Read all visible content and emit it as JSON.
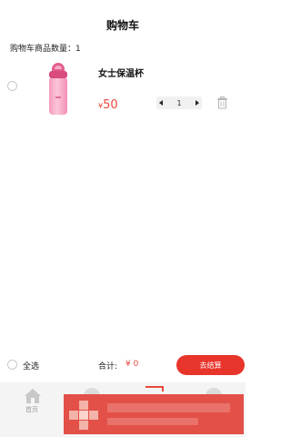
{
  "header": {
    "title": "购物车"
  },
  "cart": {
    "count_label": "购物车商品数量：",
    "count": "1",
    "items": [
      {
        "name": "女士保温杯",
        "currency": "¥",
        "price": "50",
        "quantity": "1",
        "image_icon": "thermos-bottle-image"
      }
    ]
  },
  "footer": {
    "select_all": "全选",
    "total_label": "合计:",
    "total_value": "¥ 0",
    "checkout_label": "去结算"
  },
  "tabbar": {
    "home_label": "首页"
  },
  "colors": {
    "accent": "#e8352b",
    "price": "#e8473b",
    "tabbar_bg": "#f4f4f4"
  }
}
